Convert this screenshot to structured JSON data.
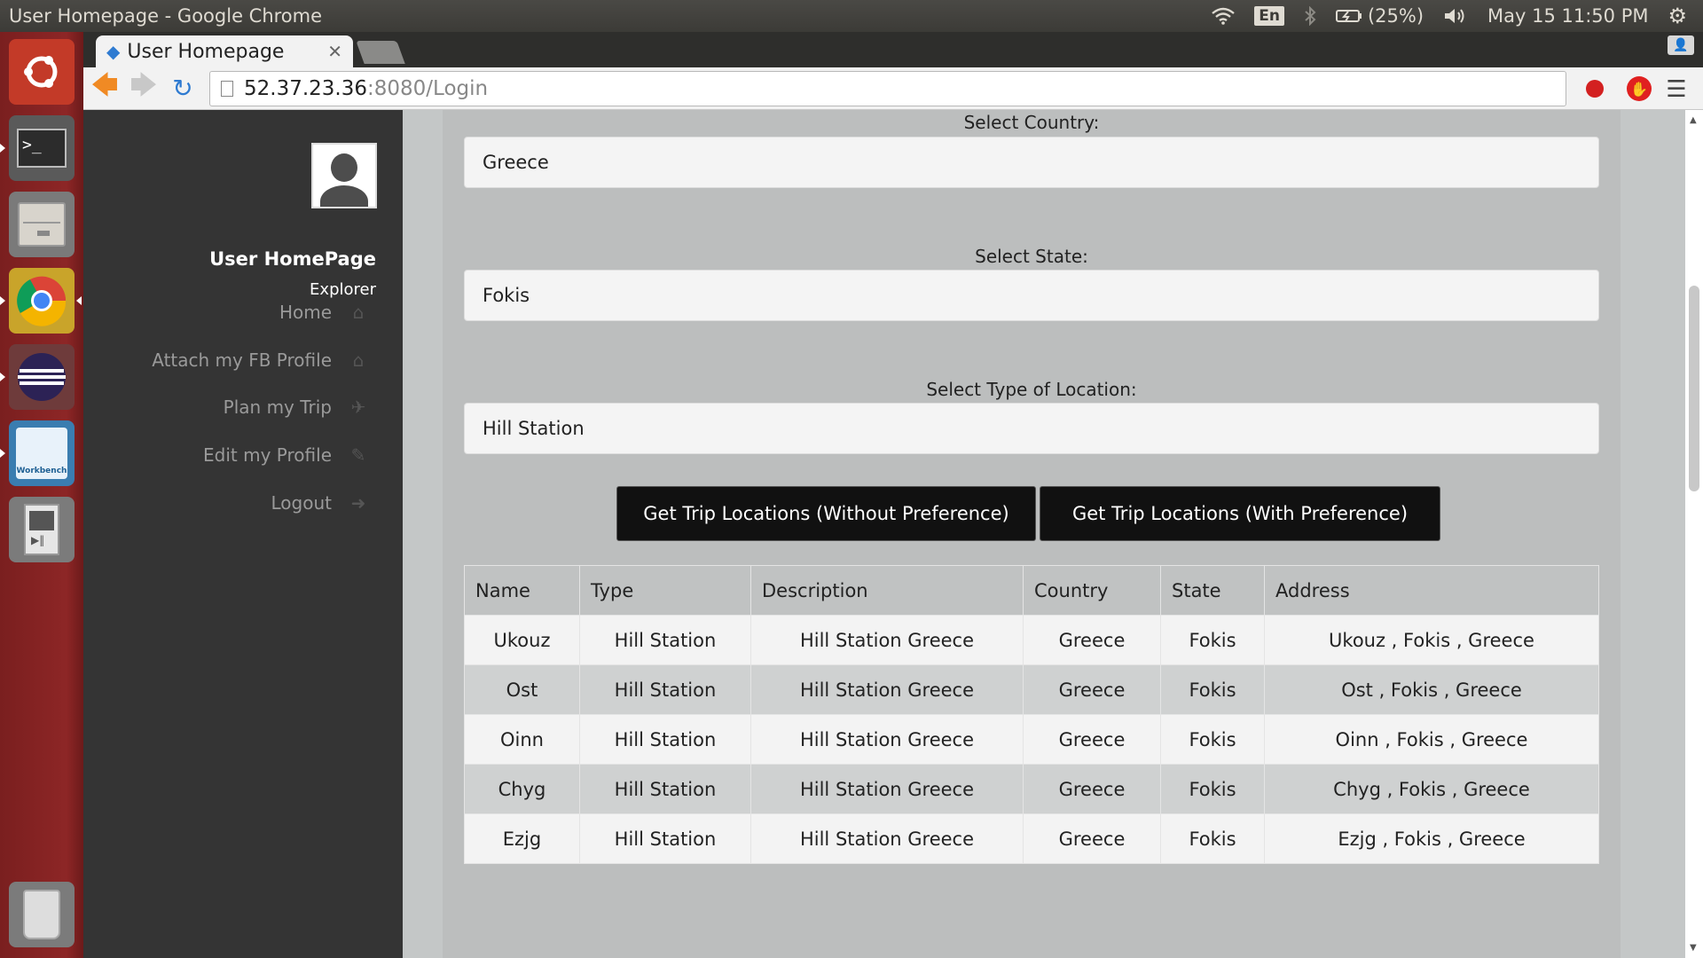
{
  "panel": {
    "window_title": "User Homepage - Google Chrome",
    "language": "En",
    "battery": "(25%)",
    "datetime": "May 15 11:50 PM"
  },
  "launcher": {
    "items": [
      "ubuntu-dash",
      "terminal",
      "file-manager",
      "chrome",
      "eclipse",
      "mysql-workbench",
      "media-player",
      "trash"
    ],
    "mysql_label": "Workbench"
  },
  "browser": {
    "tab_title": "User Homepage",
    "url_host": "52.37.23.36",
    "url_rest": ":8080/Login"
  },
  "sidebar": {
    "title": "User HomePage",
    "subtitle": "Explorer",
    "items": [
      {
        "label": "Home",
        "icon": "home-icon"
      },
      {
        "label": "Attach my FB Profile",
        "icon": "home-icon"
      },
      {
        "label": "Plan my Trip",
        "icon": "plane-icon"
      },
      {
        "label": "Edit my Profile",
        "icon": "edit-icon"
      },
      {
        "label": "Logout",
        "icon": "logout-icon"
      }
    ]
  },
  "form": {
    "country_label": "Select Country:",
    "country_value": "Greece",
    "state_label": "Select State:",
    "state_value": "Fokis",
    "type_label": "Select Type of Location:",
    "type_value": "Hill Station",
    "btn_without": "Get Trip Locations (Without Preference)",
    "btn_with": "Get Trip Locations (With Preference)"
  },
  "table": {
    "headers": [
      "Name",
      "Type",
      "Description",
      "Country",
      "State",
      "Address"
    ],
    "rows": [
      [
        "Ukouz",
        "Hill Station",
        "Hill Station Greece",
        "Greece",
        "Fokis",
        "Ukouz , Fokis , Greece"
      ],
      [
        "Ost",
        "Hill Station",
        "Hill Station Greece",
        "Greece",
        "Fokis",
        "Ost , Fokis , Greece"
      ],
      [
        "Oinn",
        "Hill Station",
        "Hill Station Greece",
        "Greece",
        "Fokis",
        "Oinn , Fokis , Greece"
      ],
      [
        "Chyg",
        "Hill Station",
        "Hill Station Greece",
        "Greece",
        "Fokis",
        "Chyg , Fokis , Greece"
      ],
      [
        "Ezjg",
        "Hill Station",
        "Hill Station Greece",
        "Greece",
        "Fokis",
        "Ezjg , Fokis , Greece"
      ]
    ]
  }
}
